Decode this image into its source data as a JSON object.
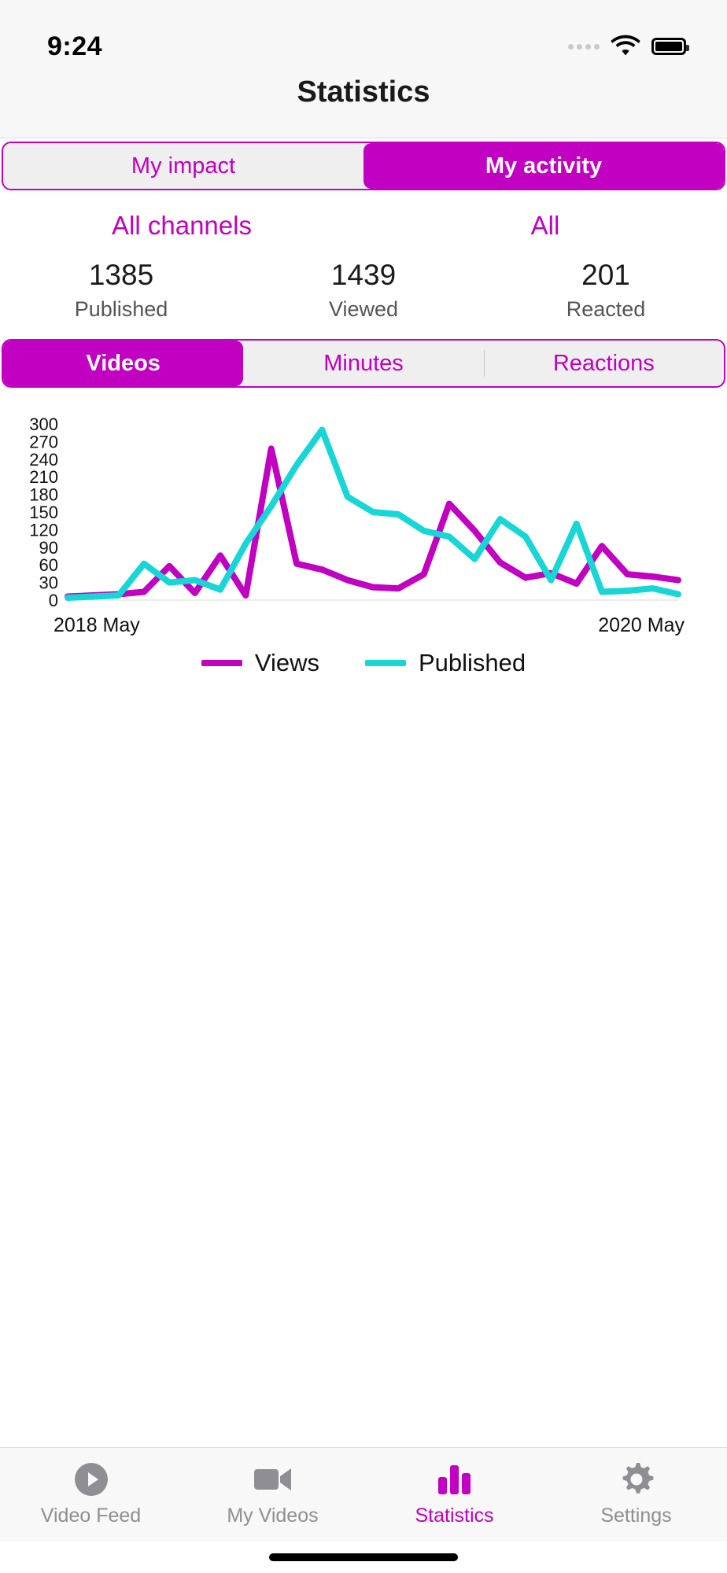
{
  "status_bar": {
    "time": "9:24",
    "signal_icon": "signal-dots-icon",
    "wifi_icon": "wifi-icon",
    "battery_icon": "battery-icon"
  },
  "header": {
    "title": "Statistics"
  },
  "scope_tabs": {
    "items": [
      {
        "label": "My impact",
        "active": false
      },
      {
        "label": "My activity",
        "active": true
      }
    ]
  },
  "filters": [
    {
      "label": "All channels"
    },
    {
      "label": "All"
    }
  ],
  "stats": [
    {
      "value": "1385",
      "label": "Published"
    },
    {
      "value": "1439",
      "label": "Viewed"
    },
    {
      "value": "201",
      "label": "Reacted"
    }
  ],
  "metric_tabs": {
    "items": [
      {
        "label": "Videos",
        "active": true
      },
      {
        "label": "Minutes",
        "active": false
      },
      {
        "label": "Reactions",
        "active": false
      }
    ]
  },
  "colors": {
    "accent": "#c100c1",
    "views_line": "#c100c1",
    "published_line": "#16d6d6",
    "inactive_text": "#8e8e93",
    "segment_bg": "#efeff0"
  },
  "chart_data": {
    "type": "line",
    "title": "",
    "xlabel": "",
    "ylabel": "",
    "ylim": [
      0,
      300
    ],
    "yticks": [
      0,
      30,
      60,
      90,
      120,
      150,
      180,
      210,
      240,
      270,
      300
    ],
    "grid": false,
    "legend_position": "bottom",
    "x_axis_labels": {
      "left": "2018 May",
      "right": "2020 May"
    },
    "x": [
      0,
      1,
      2,
      3,
      4,
      5,
      6,
      7,
      8,
      9,
      10,
      11,
      12,
      13,
      14,
      15,
      16,
      17,
      18,
      19,
      20,
      21,
      22,
      23,
      24
    ],
    "series": [
      {
        "name": "Views",
        "color": "#c100c1",
        "values": [
          6,
          8,
          10,
          14,
          58,
          12,
          76,
          8,
          258,
          62,
          52,
          34,
          22,
          20,
          44,
          164,
          118,
          64,
          38,
          46,
          28,
          92,
          44,
          40,
          34
        ]
      },
      {
        "name": "Published",
        "color": "#16d6d6",
        "values": [
          4,
          6,
          8,
          62,
          30,
          34,
          18,
          96,
          160,
          230,
          290,
          176,
          150,
          146,
          118,
          108,
          70,
          138,
          108,
          34,
          130,
          14,
          16,
          20,
          10
        ]
      }
    ],
    "legend": [
      {
        "label": "Views",
        "color": "#c100c1"
      },
      {
        "label": "Published",
        "color": "#16d6d6"
      }
    ]
  },
  "tabbar": {
    "items": [
      {
        "label": "Video Feed",
        "icon": "play-circle-icon",
        "active": false
      },
      {
        "label": "My Videos",
        "icon": "video-camera-icon",
        "active": false
      },
      {
        "label": "Statistics",
        "icon": "bar-chart-icon",
        "active": true
      },
      {
        "label": "Settings",
        "icon": "gear-icon",
        "active": false
      }
    ]
  }
}
